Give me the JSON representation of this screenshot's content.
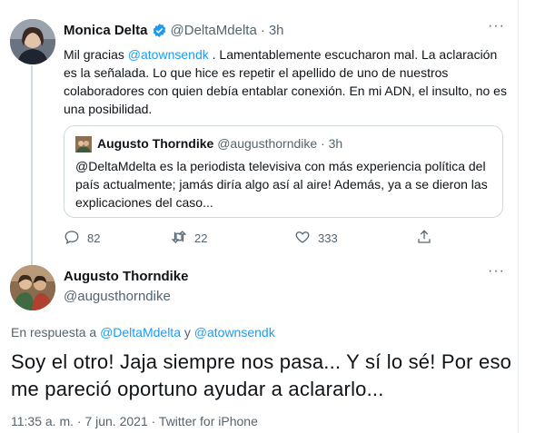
{
  "tweet1": {
    "display_name": "Monica Delta",
    "handle": "@DeltaMdelta",
    "separator": "·",
    "time": "3h",
    "more": "···",
    "body_prefix": "Mil gracias ",
    "body_mention": "@atownsendk",
    "body_rest": " . Lamentablemente escucharon mal. La aclaración es la señalada. Lo que hice es repetir el apellido de uno de nuestros colaboradores con quien debía entablar conexión. En mi ADN, el insulto, no es una posibilidad."
  },
  "quote": {
    "display_name": "Augusto Thorndike",
    "handle": "@augusthorndike",
    "separator": "·",
    "time": "3h",
    "body": "@DeltaMdelta es la periodista televisiva con más experiencia política del país actualmente; jamás diría algo así al aire! Además, ya a se dieron las explicaciones del caso..."
  },
  "actions": {
    "replies": "82",
    "retweets": "22",
    "likes": "333"
  },
  "tweet2": {
    "display_name": "Augusto Thorndike",
    "handle": "@augusthorndike",
    "more": "···",
    "reply_prefix": "En respuesta a ",
    "reply_mention1": "@DeltaMdelta",
    "reply_joiner": " y ",
    "reply_mention2": "@atownsendk",
    "text": "Soy el otro! Jaja siempre nos pasa... Y sí lo sé! Por eso me pareció oportuno ayudar a aclararlo...",
    "meta": "11:35 a. m. · 7 jun. 2021 · Twitter for iPhone"
  },
  "colors": {
    "link": "#1d9bf0",
    "muted": "#536471",
    "border": "#cfd9de"
  },
  "icons": [
    "verified-badge-icon",
    "reply-icon",
    "retweet-icon",
    "like-icon",
    "share-icon",
    "more-icon"
  ]
}
